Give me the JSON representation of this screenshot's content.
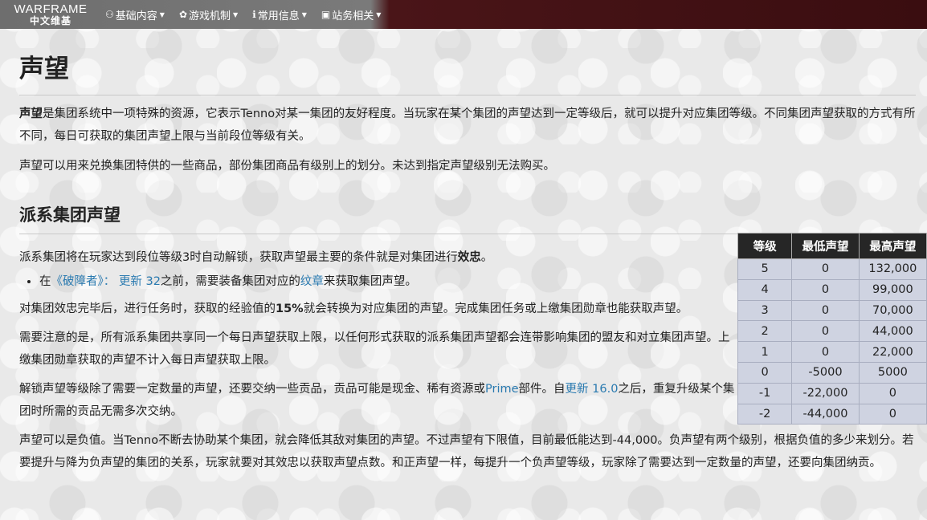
{
  "nav": {
    "logo_top": "WARFRAME",
    "logo_bottom": "中文维基",
    "items": [
      {
        "icon": "gamepad-icon",
        "glyph": "⚇",
        "label": "基础内容"
      },
      {
        "icon": "gear-icon",
        "glyph": "✿",
        "label": "游戏机制"
      },
      {
        "icon": "info-icon",
        "glyph": "ℹ",
        "label": "常用信息"
      },
      {
        "icon": "briefcase-icon",
        "glyph": "▣",
        "label": "站务相关"
      }
    ]
  },
  "page": {
    "title": "声望",
    "intro_bold": "声望",
    "intro_rest": "是集团系统中一项特殊的资源，它表示Tenno对某一集团的友好程度。当玩家在某个集团的声望达到一定等级后，就可以提升对应集团等级。不同集团声望获取的方式有所不同，每日可获取的集团声望上限与当前段位等级有关。",
    "p2": "声望可以用来兑换集团特供的一些商品，部份集团商品有级别上的划分。未达到指定声望级别无法购买。",
    "section_title": "派系集团声望",
    "p3_a": "派系集团将在玩家达到段位等级3时自动解锁，获取声望最主要的条件就是对集团进行",
    "p3_bold": "效忠",
    "p3_b": "。",
    "bullet_a": "在",
    "bullet_link1": "《破障者》：",
    "bullet_link2": "更新 32",
    "bullet_b": "之前，需要装备集团对应的",
    "bullet_link3": "纹章",
    "bullet_c": "来获取集团声望。",
    "p4_a": "对集团效忠完毕后，进行任务时，获取的经验值的",
    "p4_bold": "15%",
    "p4_b": "就会转换为对应集团的声望。完成集团任务或上缴集团勋章也能获取声望。",
    "p5": "需要注意的是，所有派系集团共享同一个每日声望获取上限，以任何形式获取的派系集团声望都会连带影响集团的盟友和对立集团声望。上缴集团勋章获取的声望不计入每日声望获取上限。",
    "p6_a": "解锁声望等级除了需要一定数量的声望，还要交纳一些贡品，贡品可能是现金、稀有资源或",
    "p6_link1": "Prime",
    "p6_b": "部件。自",
    "p6_link2": "更新 16.0",
    "p6_c": "之后，重复升级某个集团时所需的贡品无需多次交纳。",
    "p7": "声望可以是负值。当Tenno不断去协助某个集团，就会降低其敌对集团的声望。不过声望有下限值，目前最低能达到-44,000。负声望有两个级别，根据负值的多少来划分。若要提升与降为负声望的集团的关系，玩家就要对其效忠以获取声望点数。和正声望一样，每提升一个负声望等级，玩家除了需要达到一定数量的声望，还要向集团纳贡。"
  },
  "table": {
    "headers": [
      "等级",
      "最低声望",
      "最高声望"
    ],
    "rows": [
      [
        "5",
        "0",
        "132,000"
      ],
      [
        "4",
        "0",
        "99,000"
      ],
      [
        "3",
        "0",
        "70,000"
      ],
      [
        "2",
        "0",
        "44,000"
      ],
      [
        "1",
        "0",
        "22,000"
      ],
      [
        "0",
        "-5000",
        "5000"
      ],
      [
        "-1",
        "-22,000",
        "0"
      ],
      [
        "-2",
        "-44,000",
        "0"
      ]
    ]
  },
  "colors": {
    "link": "#2a7ab0",
    "nav_dark": "#3a0d10",
    "table_header": "#262626",
    "table_cell": "#cfd3e1"
  }
}
